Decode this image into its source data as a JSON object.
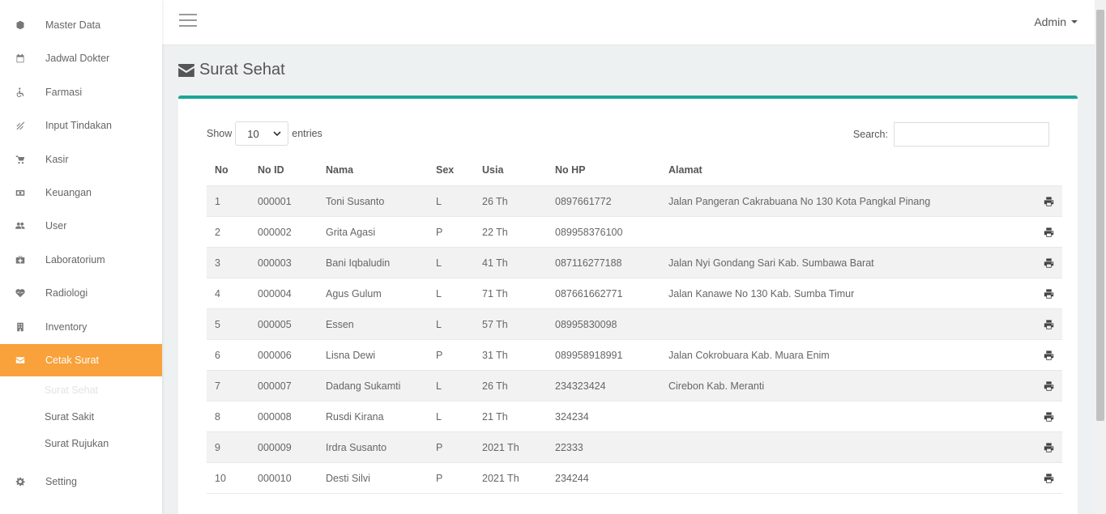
{
  "sidebar": {
    "items": [
      {
        "label": "Master Data",
        "icon": "cube-icon"
      },
      {
        "label": "Jadwal Dokter",
        "icon": "calendar-icon"
      },
      {
        "label": "Farmasi",
        "icon": "wheelchair-icon"
      },
      {
        "label": "Input Tindakan",
        "icon": "signal-icon"
      },
      {
        "label": "Kasir",
        "icon": "cart-icon"
      },
      {
        "label": "Keuangan",
        "icon": "money-icon"
      },
      {
        "label": "User",
        "icon": "users-icon"
      },
      {
        "label": "Laboratorium",
        "icon": "medkit-icon"
      },
      {
        "label": "Radiologi",
        "icon": "heartbeat-icon"
      },
      {
        "label": "Inventory",
        "icon": "building-icon"
      },
      {
        "label": "Cetak Surat",
        "icon": "envelope-icon"
      },
      {
        "label": "Setting",
        "icon": "gear-icon"
      }
    ],
    "subitems": [
      {
        "label": "Surat Sehat"
      },
      {
        "label": "Surat Sakit"
      },
      {
        "label": "Surat Rujukan"
      }
    ]
  },
  "topbar": {
    "user": "Admin"
  },
  "page": {
    "title": "Surat Sehat"
  },
  "table_controls": {
    "show_label": "Show",
    "entries_value": "10",
    "entries_label": "entries",
    "search_label": "Search:",
    "search_value": ""
  },
  "table": {
    "headers": {
      "no": "No",
      "id": "No ID",
      "nama": "Nama",
      "sex": "Sex",
      "usia": "Usia",
      "hp": "No HP",
      "alamat": "Alamat"
    },
    "rows": [
      {
        "no": "1",
        "id": "000001",
        "nama": "Toni Susanto",
        "sex": "L",
        "usia": "26 Th",
        "hp": "0897661772",
        "alamat": "Jalan Pangeran Cakrabuana No 130 Kota Pangkal Pinang"
      },
      {
        "no": "2",
        "id": "000002",
        "nama": "Grita Agasi",
        "sex": "P",
        "usia": "22 Th",
        "hp": "089958376100",
        "alamat": ""
      },
      {
        "no": "3",
        "id": "000003",
        "nama": "Bani Iqbaludin",
        "sex": "L",
        "usia": "41 Th",
        "hp": "087116277188",
        "alamat": "Jalan Nyi Gondang Sari Kab. Sumbawa Barat"
      },
      {
        "no": "4",
        "id": "000004",
        "nama": "Agus Gulum",
        "sex": "L",
        "usia": "71 Th",
        "hp": "087661662771",
        "alamat": "Jalan Kanawe No 130 Kab. Sumba Timur"
      },
      {
        "no": "5",
        "id": "000005",
        "nama": "Essen",
        "sex": "L",
        "usia": "57 Th",
        "hp": "08995830098",
        "alamat": ""
      },
      {
        "no": "6",
        "id": "000006",
        "nama": "Lisna Dewi",
        "sex": "P",
        "usia": "31 Th",
        "hp": "089958918991",
        "alamat": "Jalan Cokrobuara Kab. Muara Enim"
      },
      {
        "no": "7",
        "id": "000007",
        "nama": "Dadang Sukamti",
        "sex": "L",
        "usia": "26 Th",
        "hp": "234323424",
        "alamat": "Cirebon Kab. Meranti"
      },
      {
        "no": "8",
        "id": "000008",
        "nama": "Rusdi Kirana",
        "sex": "L",
        "usia": "21 Th",
        "hp": "324234",
        "alamat": ""
      },
      {
        "no": "9",
        "id": "000009",
        "nama": "Irdra Susanto",
        "sex": "P",
        "usia": "2021 Th",
        "hp": "22333",
        "alamat": ""
      },
      {
        "no": "10",
        "id": "000010",
        "nama": "Desti Silvi",
        "sex": "P",
        "usia": "2021 Th",
        "hp": "234244",
        "alamat": ""
      }
    ]
  },
  "colors": {
    "accent_orange": "#f9a13a",
    "accent_teal": "#1aa596"
  }
}
